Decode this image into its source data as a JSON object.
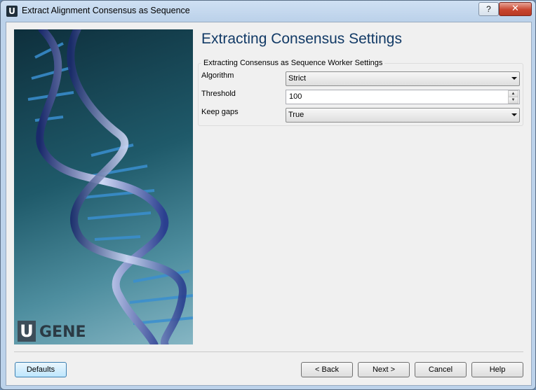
{
  "window": {
    "title": "Extract Alignment Consensus as Sequence",
    "app_icon_letter": "U",
    "help_glyph": "?",
    "close_glyph": "✕"
  },
  "banner": {
    "logo_letter": "U",
    "logo_text": "GENE"
  },
  "page": {
    "title": "Extracting Consensus Settings"
  },
  "group": {
    "label": "Extracting Consensus as Sequence Worker Settings",
    "fields": [
      {
        "label": "Algorithm",
        "value": "Strict"
      },
      {
        "label": "Threshold",
        "value": "100"
      },
      {
        "label": "Keep gaps",
        "value": "True"
      }
    ]
  },
  "buttons": {
    "defaults": "Defaults",
    "back": "< Back",
    "next": "Next >",
    "cancel": "Cancel",
    "help": "Help"
  },
  "colors": {
    "title_blue": "#123a66",
    "banner_dark": "#0e2f3c",
    "banner_light": "#86b6c4",
    "close_red": "#c8452f"
  },
  "icons": [
    "app-icon",
    "help-icon",
    "close-icon",
    "dropdown-arrow-icon",
    "spin-up-icon",
    "spin-down-icon",
    "dna-helix-image",
    "ugene-logo"
  ]
}
